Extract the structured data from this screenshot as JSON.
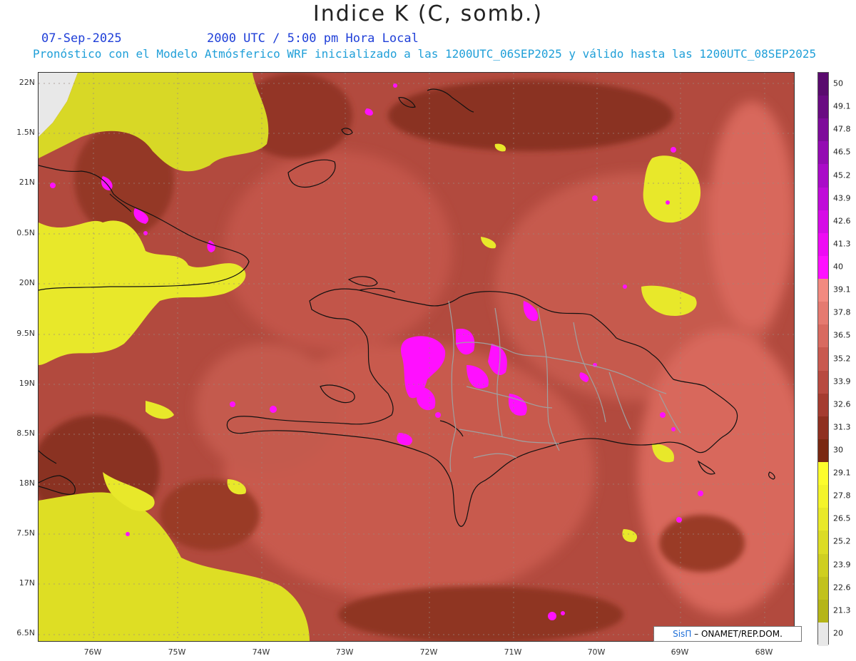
{
  "title": "Indice K (C, somb.)",
  "date": "07-Sep-2025",
  "time": "2000 UTC / 5:00 pm Hora Local",
  "subtitle": "Pronóstico con el Modelo Atmósferico WRF inicializado a las 1200UTC_06SEP2025 y válido hasta las  1200UTC_08SEP2025",
  "lat_labels": [
    "22N",
    "1.5N",
    "21N",
    "0.5N",
    "20N",
    "9.5N",
    "19N",
    "8.5N",
    "18N",
    "7.5N",
    "17N",
    "6.5N"
  ],
  "lon_labels": [
    "76W",
    "75W",
    "74W",
    "73W",
    "72W",
    "71W",
    "70W",
    "69W",
    "68W"
  ],
  "colorbar": {
    "labels": [
      "50",
      "49.1",
      "47.8",
      "46.5",
      "45.2",
      "43.9",
      "42.6",
      "41.3",
      "40",
      "39.1",
      "37.8",
      "36.5",
      "35.2",
      "33.9",
      "32.6",
      "31.3",
      "30",
      "29.1",
      "27.8",
      "26.5",
      "25.2",
      "23.9",
      "22.6",
      "21.3",
      "20"
    ],
    "colors": [
      "#5a0a6e",
      "#6a0a82",
      "#7e0a9a",
      "#940ab2",
      "#aa0ac8",
      "#c00ad8",
      "#d60ae6",
      "#ee0af4",
      "#ff10ff",
      "#f28a80",
      "#e57a70",
      "#d86a60",
      "#c95a50",
      "#b84a40",
      "#a53c30",
      "#8f3020",
      "#7a2812",
      "#fdfd2c",
      "#f4f42a",
      "#e9e928",
      "#dcdc24",
      "#cfcf20",
      "#c2c21c",
      "#b5b518",
      "#e8e8e8"
    ]
  },
  "credit": {
    "brand": "SisΠ",
    "text": "– ONAMET/REP.DOM."
  }
}
